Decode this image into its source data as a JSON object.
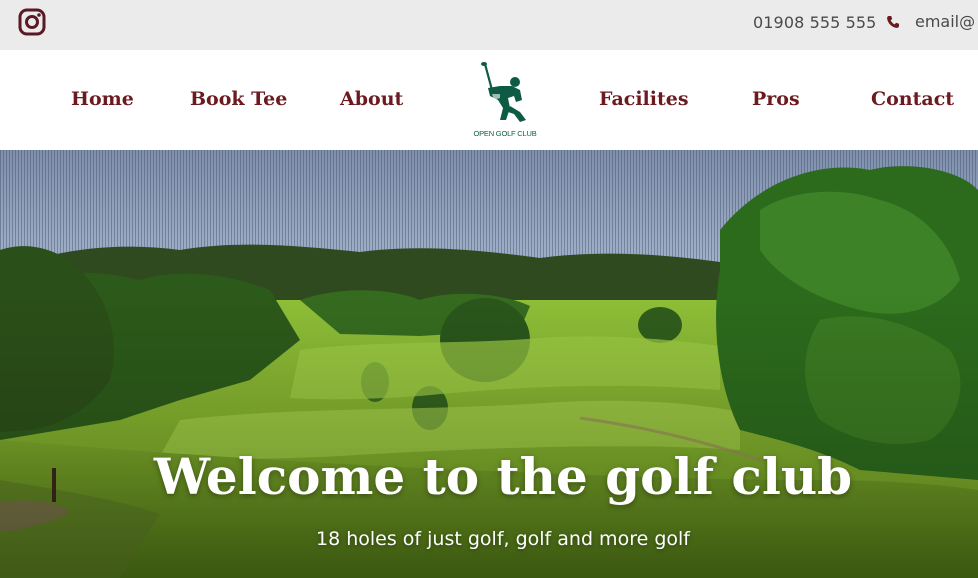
{
  "topbar": {
    "social_icon": "instagram-icon",
    "phone": "01908 555 555",
    "phone_icon": "phone-icon",
    "email": "email@"
  },
  "nav": {
    "items": [
      {
        "label": "Home"
      },
      {
        "label": "Book Tee"
      },
      {
        "label": "About"
      },
      {
        "label": "Facilites"
      },
      {
        "label": "Pros"
      },
      {
        "label": "Contact"
      }
    ],
    "logo_text": "OPEN GOLF CLUB",
    "link_color": "#6b1a1f",
    "logo_color": "#0e5b45"
  },
  "hero": {
    "title": "Welcome to the golf club",
    "subtitle": "18 holes of just golf, golf and more golf"
  }
}
